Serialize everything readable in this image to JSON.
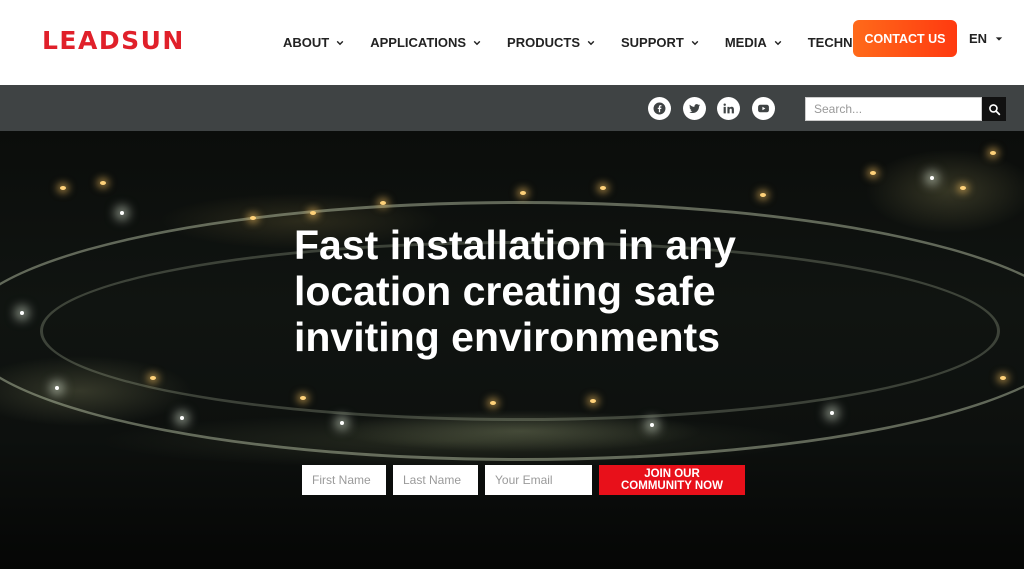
{
  "brand": {
    "logo_text": "LEADSUN",
    "logo_color": "#e0202a"
  },
  "nav": {
    "items": [
      {
        "label": "ABOUT",
        "has_dropdown": true
      },
      {
        "label": "APPLICATIONS",
        "has_dropdown": true
      },
      {
        "label": "PRODUCTS",
        "has_dropdown": true
      },
      {
        "label": "SUPPORT",
        "has_dropdown": true
      },
      {
        "label": "MEDIA",
        "has_dropdown": true
      },
      {
        "label": "TECHNOLOGY",
        "has_dropdown": false
      }
    ],
    "contact_label": "CONTACT US",
    "contact_color": "#ff4a14",
    "language": "EN"
  },
  "topbar": {
    "social": [
      {
        "icon": "facebook-icon"
      },
      {
        "icon": "twitter-icon"
      },
      {
        "icon": "linkedin-icon"
      },
      {
        "icon": "youtube-icon"
      }
    ],
    "search_placeholder": "Search...",
    "search_icon": "search-icon"
  },
  "hero": {
    "title": "Fast installation in any location creating safe inviting environments",
    "form": {
      "first_name_placeholder": "First Name",
      "last_name_placeholder": "Last Name",
      "email_placeholder": "Your Email",
      "submit_label": "JOIN OUR COMMUNITY NOW",
      "submit_color": "#e8101a"
    }
  }
}
